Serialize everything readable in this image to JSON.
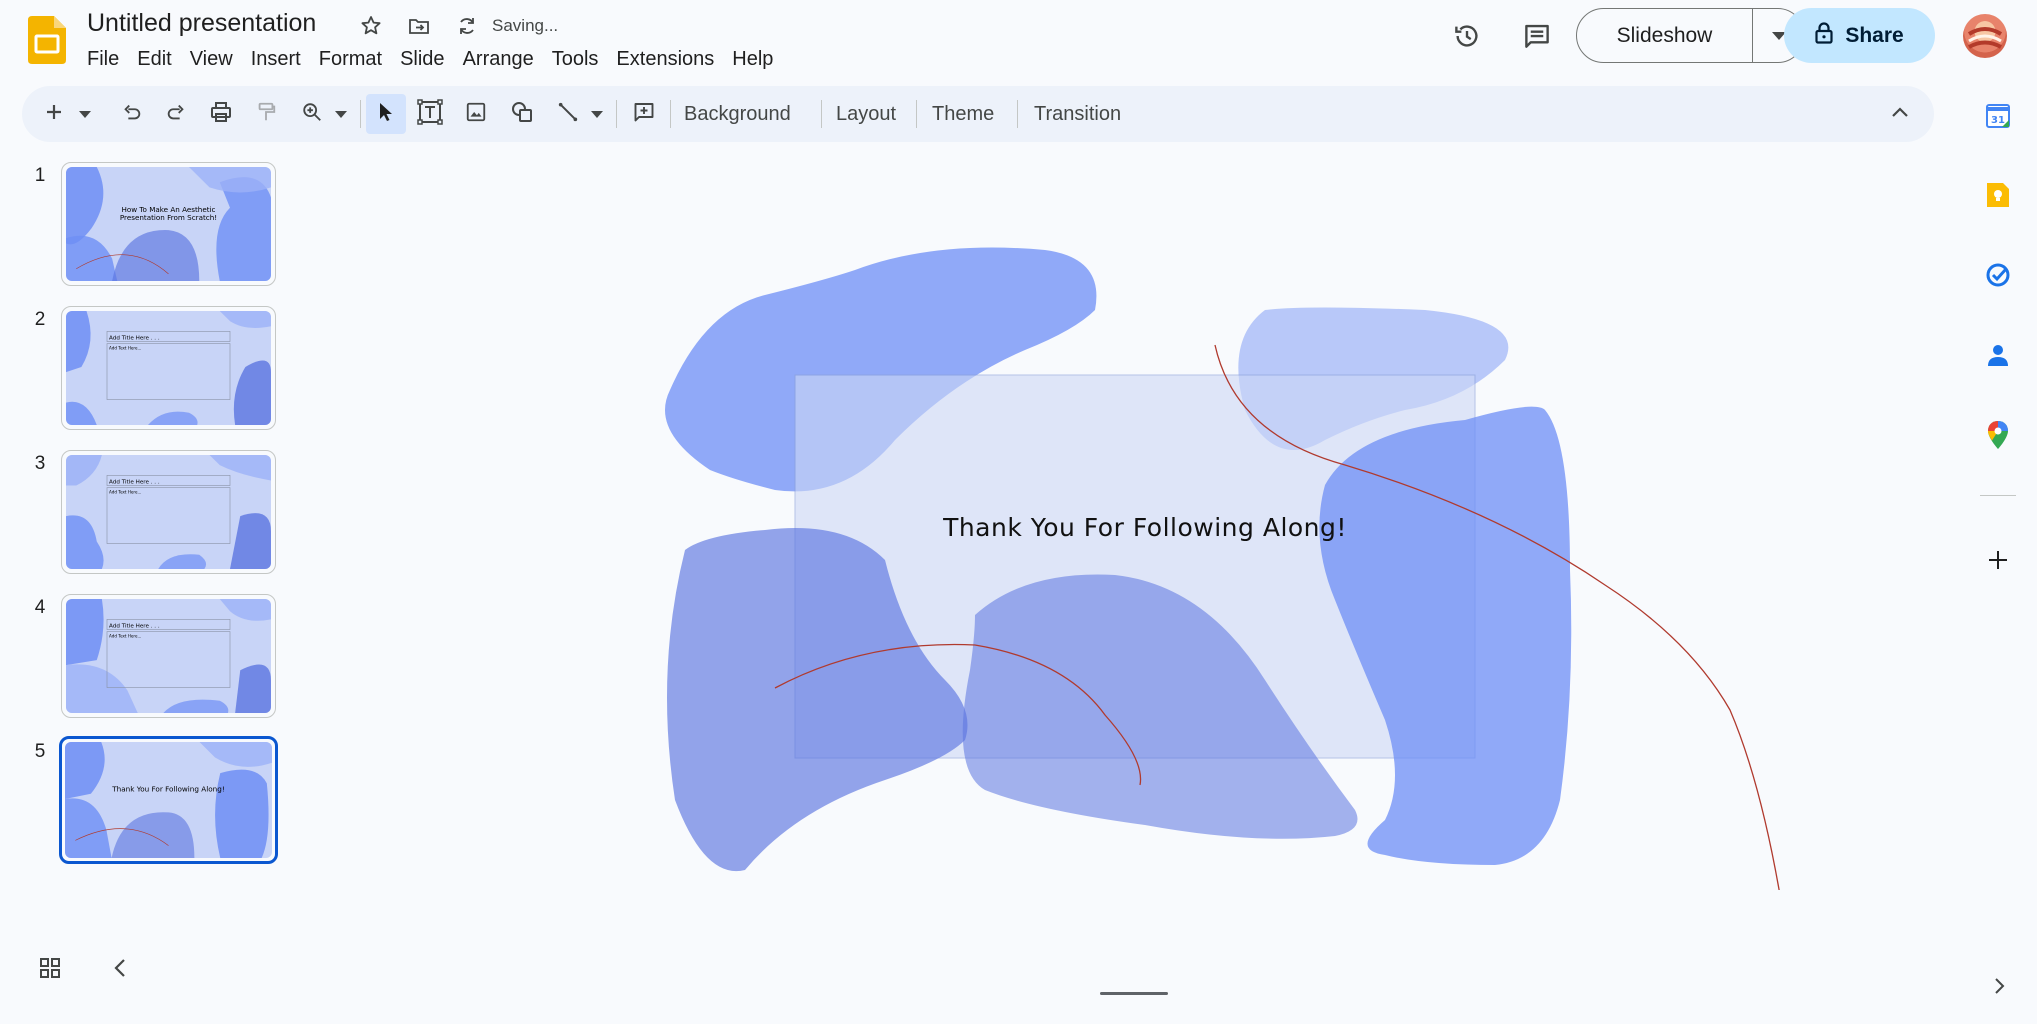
{
  "app": {
    "title": "Untitled presentation",
    "status": "Saving...",
    "brand_color": "#f4b400"
  },
  "menu": [
    "File",
    "Edit",
    "View",
    "Insert",
    "Format",
    "Slide",
    "Arrange",
    "Tools",
    "Extensions",
    "Help"
  ],
  "header": {
    "slideshow_label": "Slideshow",
    "share_label": "Share"
  },
  "toolbar": {
    "background_label": "Background",
    "layout_label": "Layout",
    "theme_label": "Theme",
    "transition_label": "Transition"
  },
  "slides": [
    {
      "number": "1",
      "title": "How To Make An Aesthetic Presentation From Scratch!",
      "body": ""
    },
    {
      "number": "2",
      "title": "Add Title Here . . .",
      "body": "Add Text Here..."
    },
    {
      "number": "3",
      "title": "Add Title Here . . .",
      "body": "Add Text Here..."
    },
    {
      "number": "4",
      "title": "Add Title Here . . .",
      "body": "Add Text Here..."
    },
    {
      "number": "5",
      "title": "Thank You For Following Along!",
      "body": ""
    }
  ],
  "selected_slide": 5,
  "canvas": {
    "text": "Thank You For Following Along!",
    "colors": {
      "blob_primary": "#6e8ef5",
      "blob_light": "#9cb2f7",
      "blob_dark": "#5b74e0",
      "textbox": "#cdd8f6",
      "line": "#b03a2e"
    }
  },
  "side_panel": [
    "calendar-icon",
    "keep-icon",
    "tasks-icon",
    "contacts-icon",
    "maps-icon",
    "add-icon"
  ]
}
